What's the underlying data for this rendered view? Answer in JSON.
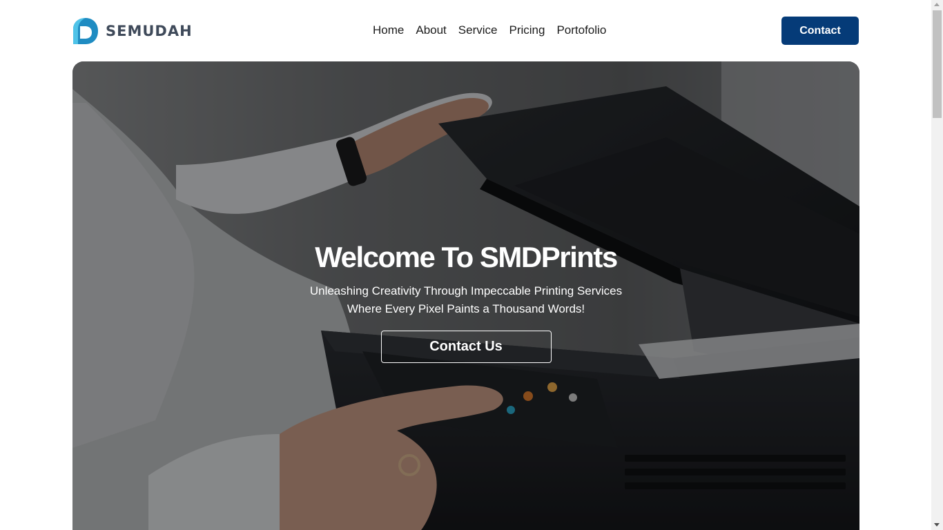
{
  "brand": {
    "name": "SEMUDAH",
    "colors": {
      "mark_dark": "#1f8cc2",
      "mark_light": "#4fc3e8",
      "text": "#3f4a5a"
    }
  },
  "nav": {
    "items": [
      "Home",
      "About",
      "Service",
      "Pricing",
      "Portofolio"
    ]
  },
  "header": {
    "contact_label": "Contact",
    "contact_color": "#053b78"
  },
  "hero": {
    "title": "Welcome To SMDPrints",
    "subtitle_line1": "Unleashing Creativity Through Impeccable Printing Services",
    "subtitle_line2": "Where Every Pixel Paints a Thousand Words!",
    "cta_label": "Contact Us",
    "image_description_icon": "printer-photo"
  }
}
